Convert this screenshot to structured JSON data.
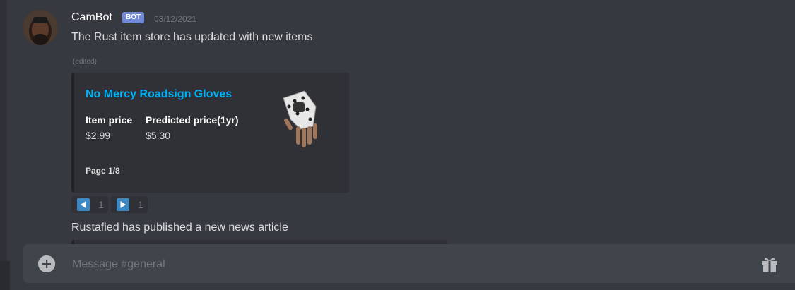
{
  "message1": {
    "username": "CamBot",
    "tag": "BOT",
    "timestamp": "03/12/2021",
    "text": "The Rust item store has updated with new items",
    "edited": "(edited)"
  },
  "embed": {
    "title": "No Mercy Roadsign Gloves",
    "fields": [
      {
        "name": "Item price",
        "value": "$2.99"
      },
      {
        "name": "Predicted price(1yr)",
        "value": "$5.30"
      }
    ],
    "footer": "Page 1/8",
    "accent": "#202225",
    "title_color": "#00aff4"
  },
  "reactions": [
    {
      "emoji": "arrow-backward-icon",
      "count": "1"
    },
    {
      "emoji": "arrow-forward-icon",
      "count": "1"
    }
  ],
  "message2": {
    "text": "Rustafied has published a new news article"
  },
  "input": {
    "placeholder": "Message #general"
  },
  "icons": {
    "attach": "add-circle-icon",
    "gift": "gift-icon"
  }
}
